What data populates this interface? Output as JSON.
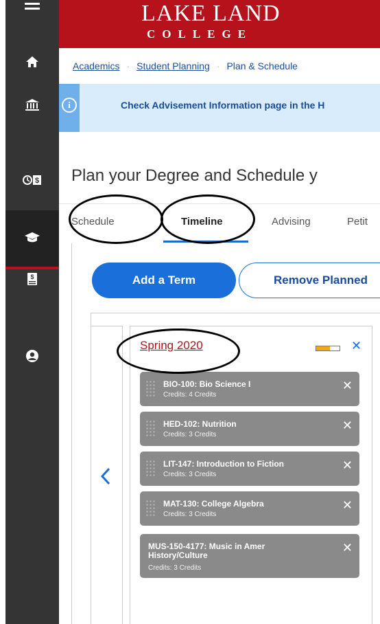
{
  "sidebar": {
    "items": [
      {
        "icon": "menu-icon"
      },
      {
        "icon": "home-icon"
      },
      {
        "icon": "bank-icon"
      },
      {
        "icon": "time-money-icon"
      },
      {
        "icon": "graduation-cap-icon"
      },
      {
        "icon": "dollar-document-icon"
      },
      {
        "icon": "user-icon"
      }
    ]
  },
  "header": {
    "logo_top": "LAKE LAND",
    "logo_bottom": "COLLEGE",
    "bg_color": "#b5121b"
  },
  "breadcrumb": {
    "items": [
      "Academics",
      "Student Planning",
      "Plan & Schedule"
    ]
  },
  "alert": {
    "icon": "info-icon",
    "text": "Check Advisement Information page in the H"
  },
  "page": {
    "title": "Plan your Degree and Schedule y"
  },
  "tabs": [
    {
      "label": "Schedule"
    },
    {
      "label": "Timeline",
      "active": true
    },
    {
      "label": "Advising"
    },
    {
      "label": "Petit"
    }
  ],
  "actions": {
    "add_term": "Add a Term",
    "remove_planned": "Remove Planned"
  },
  "timeline": {
    "term": {
      "title": "Spring 2020",
      "progress": 0.6,
      "progress_color": "#f3a51b"
    },
    "courses": [
      {
        "name": "BIO-100: Bio Science I",
        "credits": "Credits: 4 Credits"
      },
      {
        "name": "HED-102: Nutrition",
        "credits": "Credits: 3 Credits"
      },
      {
        "name": "LIT-147: Introduction to Fiction",
        "credits": "Credits: 3 Credits"
      },
      {
        "name": "MAT-130: College Algebra",
        "credits": "Credits: 3 Credits"
      },
      {
        "name": "MUS-150-4177: Music in Amer History/Culture",
        "credits": "Credits: 3 Credits"
      }
    ]
  }
}
